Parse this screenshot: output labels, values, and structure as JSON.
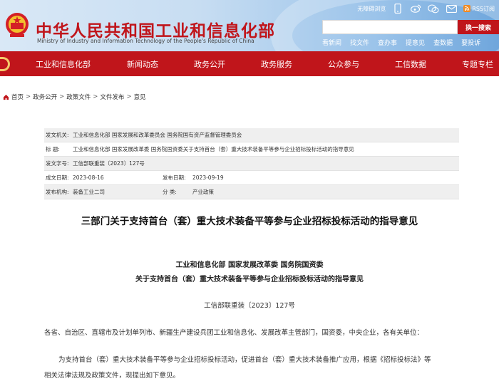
{
  "header": {
    "title_cn": "中华人民共和国工业和信息化部",
    "title_en": "Ministry of Industry and Information Technology of the People's Republic of China",
    "top_links": {
      "accessibility": "无障碍浏览",
      "rss": "RSS订阅"
    },
    "search": {
      "button": "换一搜索",
      "placeholder": ""
    },
    "quick_links": [
      "看新闻",
      "找文件",
      "查办事",
      "提意见",
      "查数据",
      "要投诉"
    ]
  },
  "nav": {
    "items": [
      "工业和信息化部",
      "新闻动态",
      "政务公开",
      "政务服务",
      "公众参与",
      "工信数据",
      "专题专栏"
    ]
  },
  "breadcrumb": [
    "首页",
    "政务公开",
    "政策文件",
    "文件发布",
    "意见"
  ],
  "info": {
    "issuer_label": "发文机关:",
    "issuer": "工业和信息化部 国家发展和改革委员会 国务院国有资产监督管理委员会",
    "title_label": "标      题:",
    "title": "工业和信息化部 国家发展改革委 国务院国资委关于支持首台（套）重大技术装备平等参与企业招标投标活动的指导意见",
    "docno_label": "发文字号:",
    "docno": "工信部联重装〔2023〕127号",
    "created_label": "成文日期:",
    "created": "2023-08-16",
    "published_label": "发布日期:",
    "published": "2023-09-19",
    "dept_label": "发布机构:",
    "dept": "装备工业二司",
    "category_label": "分      类:",
    "category": "产业政策"
  },
  "article": {
    "title": "三部门关于支持首台（套）重大技术装备平等参与企业招标投标活动的指导意见",
    "issuers": "工业和信息化部  国家发展改革委  国务院国资委",
    "subtitle": "关于支持首台（套）重大技术装备平等参与企业招标投标活动的指导意见",
    "doc_no": "工信部联重装〔2023〕127号",
    "addressee": "各省、自治区、直辖市及计划单列市、新疆生产建设兵团工业和信息化、发展改革主管部门，国资委，中央企业，各有关单位：",
    "para1_line1": "为支持首台（套）重大技术装备平等参与企业招标投标活动，促进首台（套）重大技术装备推广应用，根据《招标投标法》等",
    "para1_line2": "相关法律法规及政策文件，现提出如下意见。"
  },
  "colors": {
    "brand_red": "#c0151b",
    "header_blue": "#9cc4ea",
    "gold": "#f4c96b"
  },
  "icons": [
    "emblem-icon",
    "mobile-icon",
    "weibo-icon",
    "wechat-icon",
    "mail-icon",
    "rss-icon",
    "home-icon"
  ]
}
